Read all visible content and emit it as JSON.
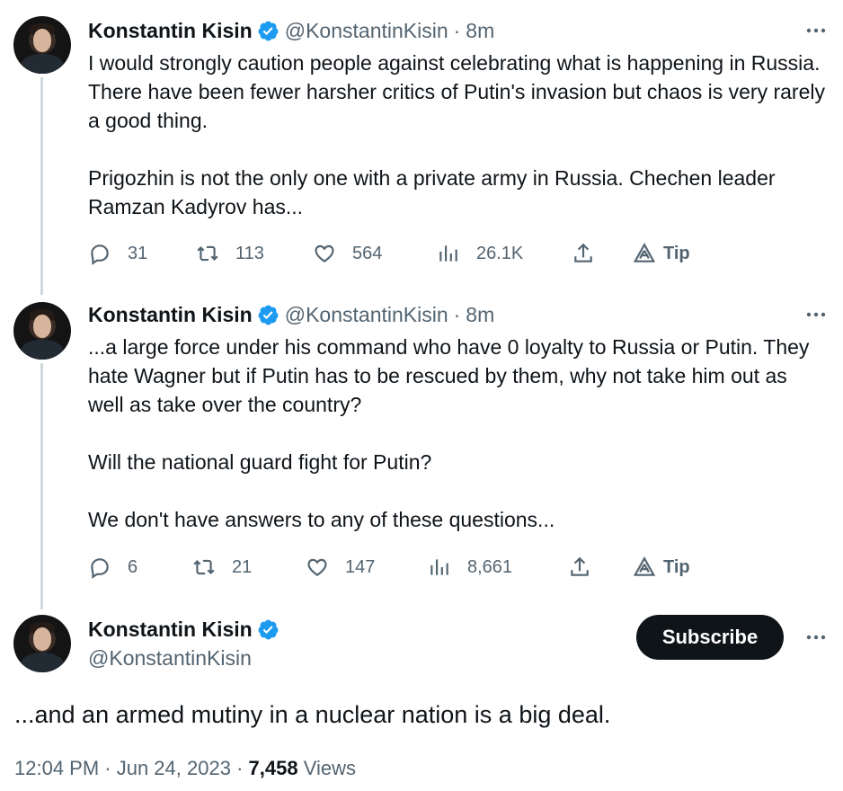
{
  "author": {
    "name": "Konstantin Kisin",
    "handle": "@KonstantinKisin"
  },
  "colors": {
    "verified_blue": "#1d9bf0",
    "text_primary": "#0f1419",
    "text_secondary": "#536471",
    "thread_line": "#cfd9de",
    "button_dark": "#0f1419"
  },
  "thread": [
    {
      "time": "8m",
      "paragraphs": [
        "I would strongly caution people against celebrating what is happening in Russia. There have been fewer harsher critics of Putin's invasion but chaos is very rarely a good thing.",
        "Prigozhin is not the only one with a private army in Russia. Chechen leader Ramzan Kadyrov has..."
      ],
      "stats": {
        "replies": "31",
        "reposts": "113",
        "likes": "564",
        "views": "26.1K"
      }
    },
    {
      "time": "8m",
      "paragraphs": [
        "...a large force under his command who have 0 loyalty to Russia or Putin. They hate Wagner but if Putin has to be rescued by them, why not take him out as well as take over the country?",
        "Will the national guard fight for Putin?",
        "We don't have answers to any of these questions..."
      ],
      "stats": {
        "replies": "6",
        "reposts": "21",
        "likes": "147",
        "views": "8,661"
      }
    }
  ],
  "actions": {
    "tip_label": "Tip"
  },
  "main_tweet": {
    "subscribe_label": "Subscribe",
    "text": "...and an armed mutiny in a nuclear nation is a big deal.",
    "timestamp": "12:04 PM · Jun 24, 2023",
    "views_count": "7,458",
    "views_label": "Views"
  }
}
